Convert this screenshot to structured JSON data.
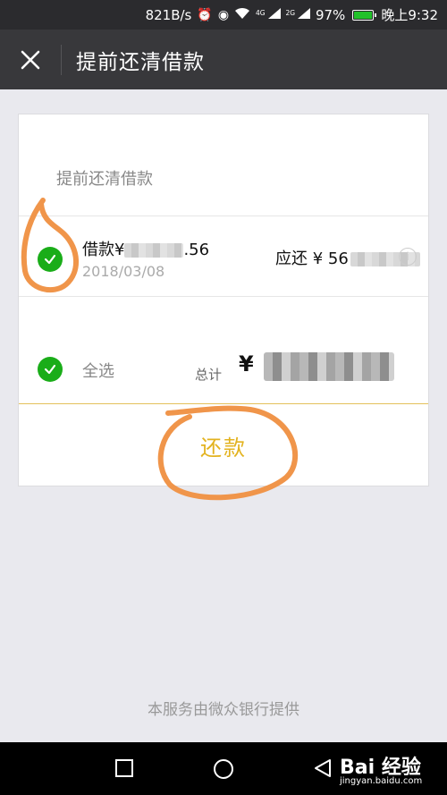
{
  "status_bar": {
    "net_speed": "821B/s",
    "signal_4g": "4G",
    "signal_2g": "2G",
    "battery_pct": "97%",
    "time": "晚上9:32",
    "icons": [
      "alarm-icon",
      "eye-icon",
      "wifi-icon",
      "cell-signal-icon",
      "battery-icon"
    ]
  },
  "header": {
    "title": "提前还清借款",
    "close_icon": "close-icon"
  },
  "card": {
    "section_title": "提前还清借款",
    "loan": {
      "name_prefix": "借款¥",
      "name_suffix": ".56",
      "date": "2018/03/08",
      "due_prefix": "应还 ¥ 56",
      "checked": true
    },
    "select_all_label": "全选",
    "total_label": "总计",
    "total_currency": "¥",
    "repay_button_label": "还款"
  },
  "footer_note": "本服务由微众银行提供",
  "watermark": {
    "brand": "Bai 经验",
    "url": "jingyan.baidu.com"
  },
  "colors": {
    "accent_green": "#1aad19",
    "repay_gold": "#e3b320",
    "annotation_orange": "#f0954a",
    "header_bg": "#38383b"
  }
}
